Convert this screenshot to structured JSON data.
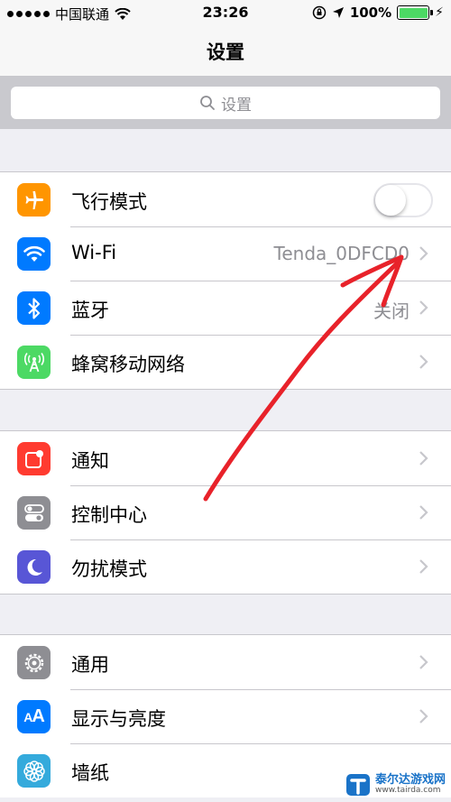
{
  "status_bar": {
    "carrier": "中国联通",
    "time": "23:26",
    "battery": "100%"
  },
  "nav": {
    "title": "设置"
  },
  "search": {
    "placeholder": "设置"
  },
  "groups": [
    {
      "items": [
        {
          "label": "飞行模式",
          "icon": "airplane-icon",
          "color": "#ff9500",
          "control": "toggle",
          "toggle_on": false
        },
        {
          "label": "Wi-Fi",
          "icon": "wifi-icon",
          "color": "#007aff",
          "value": "Tenda_0DFCD0"
        },
        {
          "label": "蓝牙",
          "icon": "bluetooth-icon",
          "color": "#007aff",
          "value": "关闭"
        },
        {
          "label": "蜂窝移动网络",
          "icon": "cellular-icon",
          "color": "#4cd964"
        }
      ]
    },
    {
      "items": [
        {
          "label": "通知",
          "icon": "notifications-icon",
          "color": "#ff3b30"
        },
        {
          "label": "控制中心",
          "icon": "control-center-icon",
          "color": "#8e8e93"
        },
        {
          "label": "勿扰模式",
          "icon": "moon-icon",
          "color": "#5856d6"
        }
      ]
    },
    {
      "items": [
        {
          "label": "通用",
          "icon": "gear-icon",
          "color": "#8e8e93"
        },
        {
          "label": "显示与亮度",
          "icon": "display-icon",
          "color": "#007aff"
        },
        {
          "label": "墙纸",
          "icon": "wallpaper-icon",
          "color": "#34aadc"
        }
      ]
    }
  ],
  "watermark": {
    "name": "泰尔达游戏网",
    "url": "www.tairda.com"
  },
  "annotation_color": "#e8222a"
}
